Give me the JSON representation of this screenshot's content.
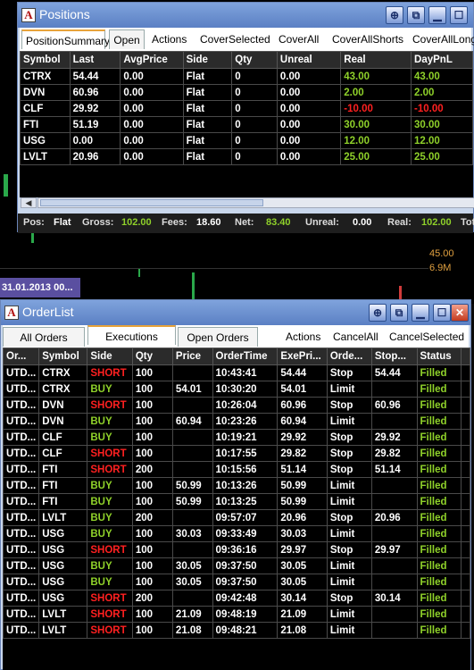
{
  "background": {
    "date_label": "31.01.2013 00...",
    "price_label": "45.00",
    "volume_label": "6.9M"
  },
  "positions": {
    "title": "Positions",
    "tabs": [
      "PositionSummary",
      "Open"
    ],
    "actions": [
      "Actions",
      "CoverSelected",
      "CoverAll",
      "CoverAllShorts",
      "CoverAllLongs"
    ],
    "columns": [
      "Symbol",
      "Last",
      "AvgPrice",
      "Side",
      "Qty",
      "Unreal",
      "Real",
      "DayPnL"
    ],
    "rows": [
      [
        "CTRX",
        "54.44",
        "0.00",
        "Flat",
        "0",
        "0.00",
        "43.00",
        "43.00"
      ],
      [
        "DVN",
        "60.96",
        "0.00",
        "Flat",
        "0",
        "0.00",
        "2.00",
        "2.00"
      ],
      [
        "CLF",
        "29.92",
        "0.00",
        "Flat",
        "0",
        "0.00",
        "-10.00",
        "-10.00"
      ],
      [
        "FTI",
        "51.19",
        "0.00",
        "Flat",
        "0",
        "0.00",
        "30.00",
        "30.00"
      ],
      [
        "USG",
        "0.00",
        "0.00",
        "Flat",
        "0",
        "0.00",
        "12.00",
        "12.00"
      ],
      [
        "LVLT",
        "20.96",
        "0.00",
        "Flat",
        "0",
        "0.00",
        "25.00",
        "25.00"
      ]
    ],
    "status": {
      "pos_label": "Pos:",
      "pos_value": "Flat",
      "gross_label": "Gross:",
      "gross_value": "102.00",
      "fees_label": "Fees:",
      "fees_value": "18.60",
      "net_label": "Net:",
      "net_value": "83.40",
      "unreal_label": "Unreal:",
      "unreal_value": "0.00",
      "real_label": "Real:",
      "real_value": "102.00",
      "tot_label": "Tot"
    }
  },
  "orderlist": {
    "title": "OrderList",
    "tabs": [
      "All Orders",
      "Executions",
      "Open Orders"
    ],
    "actions": [
      "Actions",
      "CancelAll",
      "CancelSelected"
    ],
    "columns": [
      "Or...",
      "Symbol",
      "Side",
      "Qty",
      "Price",
      "OrderTime",
      "ExePri...",
      "Orde...",
      "Stop...",
      "Status"
    ],
    "rows": [
      [
        "UTD...",
        "CTRX",
        "SHORT",
        "100",
        "",
        "10:43:41",
        "54.44",
        "Stop",
        "54.44",
        "Filled"
      ],
      [
        "UTD...",
        "CTRX",
        "BUY",
        "100",
        "54.01",
        "10:30:20",
        "54.01",
        "Limit",
        "",
        "Filled"
      ],
      [
        "UTD...",
        "DVN",
        "SHORT",
        "100",
        "",
        "10:26:04",
        "60.96",
        "Stop",
        "60.96",
        "Filled"
      ],
      [
        "UTD...",
        "DVN",
        "BUY",
        "100",
        "60.94",
        "10:23:26",
        "60.94",
        "Limit",
        "",
        "Filled"
      ],
      [
        "UTD...",
        "CLF",
        "BUY",
        "100",
        "",
        "10:19:21",
        "29.92",
        "Stop",
        "29.92",
        "Filled"
      ],
      [
        "UTD...",
        "CLF",
        "SHORT",
        "100",
        "",
        "10:17:55",
        "29.82",
        "Stop",
        "29.82",
        "Filled"
      ],
      [
        "UTD...",
        "FTI",
        "SHORT",
        "200",
        "",
        "10:15:56",
        "51.14",
        "Stop",
        "51.14",
        "Filled"
      ],
      [
        "UTD...",
        "FTI",
        "BUY",
        "100",
        "50.99",
        "10:13:26",
        "50.99",
        "Limit",
        "",
        "Filled"
      ],
      [
        "UTD...",
        "FTI",
        "BUY",
        "100",
        "50.99",
        "10:13:25",
        "50.99",
        "Limit",
        "",
        "Filled"
      ],
      [
        "UTD...",
        "LVLT",
        "BUY",
        "200",
        "",
        "09:57:07",
        "20.96",
        "Stop",
        "20.96",
        "Filled"
      ],
      [
        "UTD...",
        "USG",
        "BUY",
        "100",
        "30.03",
        "09:33:49",
        "30.03",
        "Limit",
        "",
        "Filled"
      ],
      [
        "UTD...",
        "USG",
        "SHORT",
        "100",
        "",
        "09:36:16",
        "29.97",
        "Stop",
        "29.97",
        "Filled"
      ],
      [
        "UTD...",
        "USG",
        "BUY",
        "100",
        "30.05",
        "09:37:50",
        "30.05",
        "Limit",
        "",
        "Filled"
      ],
      [
        "UTD...",
        "USG",
        "BUY",
        "100",
        "30.05",
        "09:37:50",
        "30.05",
        "Limit",
        "",
        "Filled"
      ],
      [
        "UTD...",
        "USG",
        "SHORT",
        "200",
        "",
        "09:42:48",
        "30.14",
        "Stop",
        "30.14",
        "Filled"
      ],
      [
        "UTD...",
        "LVLT",
        "SHORT",
        "100",
        "21.09",
        "09:48:19",
        "21.09",
        "Limit",
        "",
        "Filled"
      ],
      [
        "UTD...",
        "LVLT",
        "SHORT",
        "100",
        "21.08",
        "09:48:21",
        "21.08",
        "Limit",
        "",
        "Filled"
      ]
    ]
  },
  "colors": {
    "positive": "#8fd12a",
    "negative": "#ff2020",
    "titlebar": "#5b80c4"
  }
}
